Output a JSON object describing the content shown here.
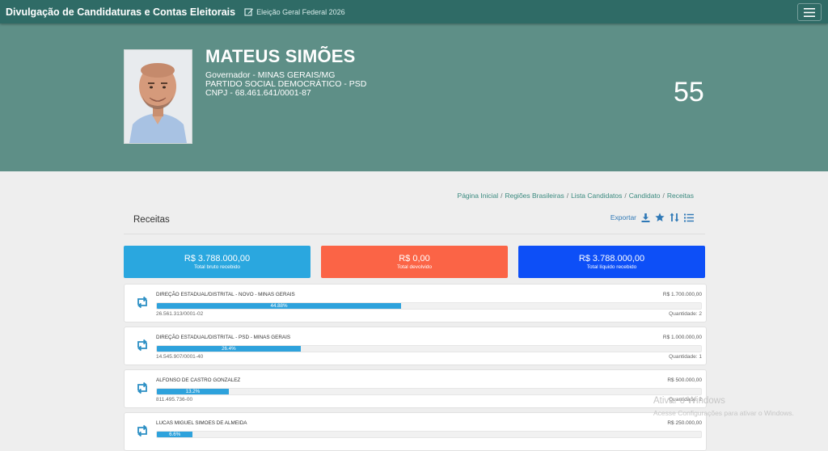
{
  "navbar": {
    "title": "Divulgação de Candidaturas e Contas Eleitorais",
    "election": "Eleição Geral Federal 2026",
    "menu_icon": "hamburger-icon"
  },
  "candidate": {
    "name": "MATEUS SIMÕES",
    "office": "Governador - MINAS GERAIS/MG",
    "party": "PARTIDO SOCIAL DEMOCRÁTICO - PSD",
    "cnpj": "CNPJ - 68.461.641/0001-87",
    "number": "55"
  },
  "breadcrumb": [
    "Página Inicial",
    "Regiões Brasileiras",
    "Lista Candidatos",
    "Candidato",
    "Receitas"
  ],
  "breadcrumb_separator": "/",
  "section": {
    "title": "Receitas",
    "export_label": "Exportar",
    "tool_icons": [
      "download-icon",
      "star-icon",
      "sort-icon",
      "list-icon"
    ]
  },
  "summary": [
    {
      "value": "R$ 3.788.000,00",
      "label": "Total bruto recebido",
      "color": "#2aa7df"
    },
    {
      "value": "R$ 0,00",
      "label": "Total devolvido",
      "color": "#fb6446"
    },
    {
      "value": "R$ 3.788.000,00",
      "label": "Total líquido recebido",
      "color": "#0d4ff7"
    }
  ],
  "receitas": [
    {
      "name": "DIREÇÃO ESTADUAL/DISTRITAL - NOVO - MINAS GERAIS",
      "amount": "R$ 1.700.000,00",
      "percent_label": "44.88%",
      "percent": 44.88,
      "doc": "26.561.313/0001-02",
      "quantity": "Quantidade: 2"
    },
    {
      "name": "DIREÇÃO ESTADUAL/DISTRITAL - PSD - MINAS GERAIS",
      "amount": "R$ 1.000.000,00",
      "percent_label": "26.4%",
      "percent": 26.4,
      "doc": "14.545.907/0001-40",
      "quantity": "Quantidade: 1"
    },
    {
      "name": "ALFONSO DE CASTRO GONZALEZ",
      "amount": "R$ 500.000,00",
      "percent_label": "13.2%",
      "percent": 13.2,
      "doc": "811.495.736-00",
      "quantity": "Quantidade: 2"
    },
    {
      "name": "LUCAS MIGUEL SIMOES DE ALMEIDA",
      "amount": "R$ 250.000,00",
      "percent_label": "6.6%",
      "percent": 6.6,
      "doc": "",
      "quantity": ""
    }
  ],
  "watermark": {
    "title": "Ativar o Windows",
    "subtitle": "Acesse Configurações para ativar o Windows."
  },
  "colors": {
    "navbar": "#2f6b66",
    "hero": "#5e8f87",
    "link": "#3a8a7f",
    "progress": "#2ea2dc",
    "accent_icon": "#2e78b6"
  }
}
